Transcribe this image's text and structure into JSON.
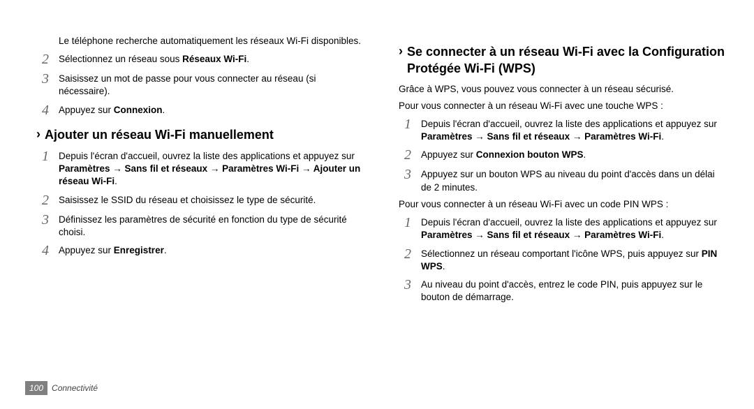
{
  "left": {
    "intro": "Le téléphone recherche automatiquement les réseaux Wi-Fi disponibles.",
    "step2_a": "Sélectionnez un réseau sous ",
    "step2_b": "Réseaux Wi-Fi",
    "step2_c": ".",
    "step3": "Saisissez un mot de passe pour vous connecter au réseau (si nécessaire).",
    "step4_a": "Appuyez sur ",
    "step4_b": "Connexion",
    "step4_c": ".",
    "heading1": "Ajouter un réseau Wi-Fi manuellement",
    "manual": {
      "s1_a": "Depuis l'écran d'accueil, ouvrez la liste des applications et appuyez sur ",
      "s1_b": "Paramètres → Sans fil et réseaux → Paramètres Wi-Fi → Ajouter un réseau Wi-Fi",
      "s1_c": ".",
      "s2": "Saisissez le SSID du réseau et choisissez le type de sécurité.",
      "s3": "Définissez les paramètres de sécurité en fonction du type de sécurité choisi.",
      "s4_a": "Appuyez sur ",
      "s4_b": "Enregistrer",
      "s4_c": "."
    }
  },
  "right": {
    "heading2": "Se connecter à un réseau Wi-Fi avec la Configuration Protégée Wi-Fi (WPS)",
    "intro2": "Grâce à WPS, vous pouvez vous connecter à un réseau sécurisé.",
    "p_button": "Pour vous connecter à un réseau Wi-Fi avec une touche WPS :",
    "button": {
      "s1_a": "Depuis l'écran d'accueil, ouvrez la liste des applications et appuyez sur ",
      "s1_b": "Paramètres → Sans fil et réseaux → Paramètres Wi-Fi",
      "s1_c": ".",
      "s2_a": "Appuyez sur ",
      "s2_b": "Connexion bouton WPS",
      "s2_c": ".",
      "s3": "Appuyez sur un bouton WPS au niveau du point d'accès dans un délai de 2 minutes."
    },
    "p_pin": "Pour vous connecter à un réseau Wi-Fi avec un code PIN WPS :",
    "pin": {
      "s1_a": "Depuis l'écran d'accueil, ouvrez la liste des applications et appuyez sur ",
      "s1_b": "Paramètres → Sans fil et réseaux → Paramètres Wi-Fi",
      "s1_c": ".",
      "s2_a": "Sélectionnez un réseau comportant l'icône WPS, puis appuyez sur ",
      "s2_b": "PIN WPS",
      "s2_c": ".",
      "s3": "Au niveau du point d'accès, entrez le code PIN, puis appuyez sur le bouton de démarrage."
    }
  },
  "footer": {
    "page": "100",
    "section": "Connectivité"
  }
}
